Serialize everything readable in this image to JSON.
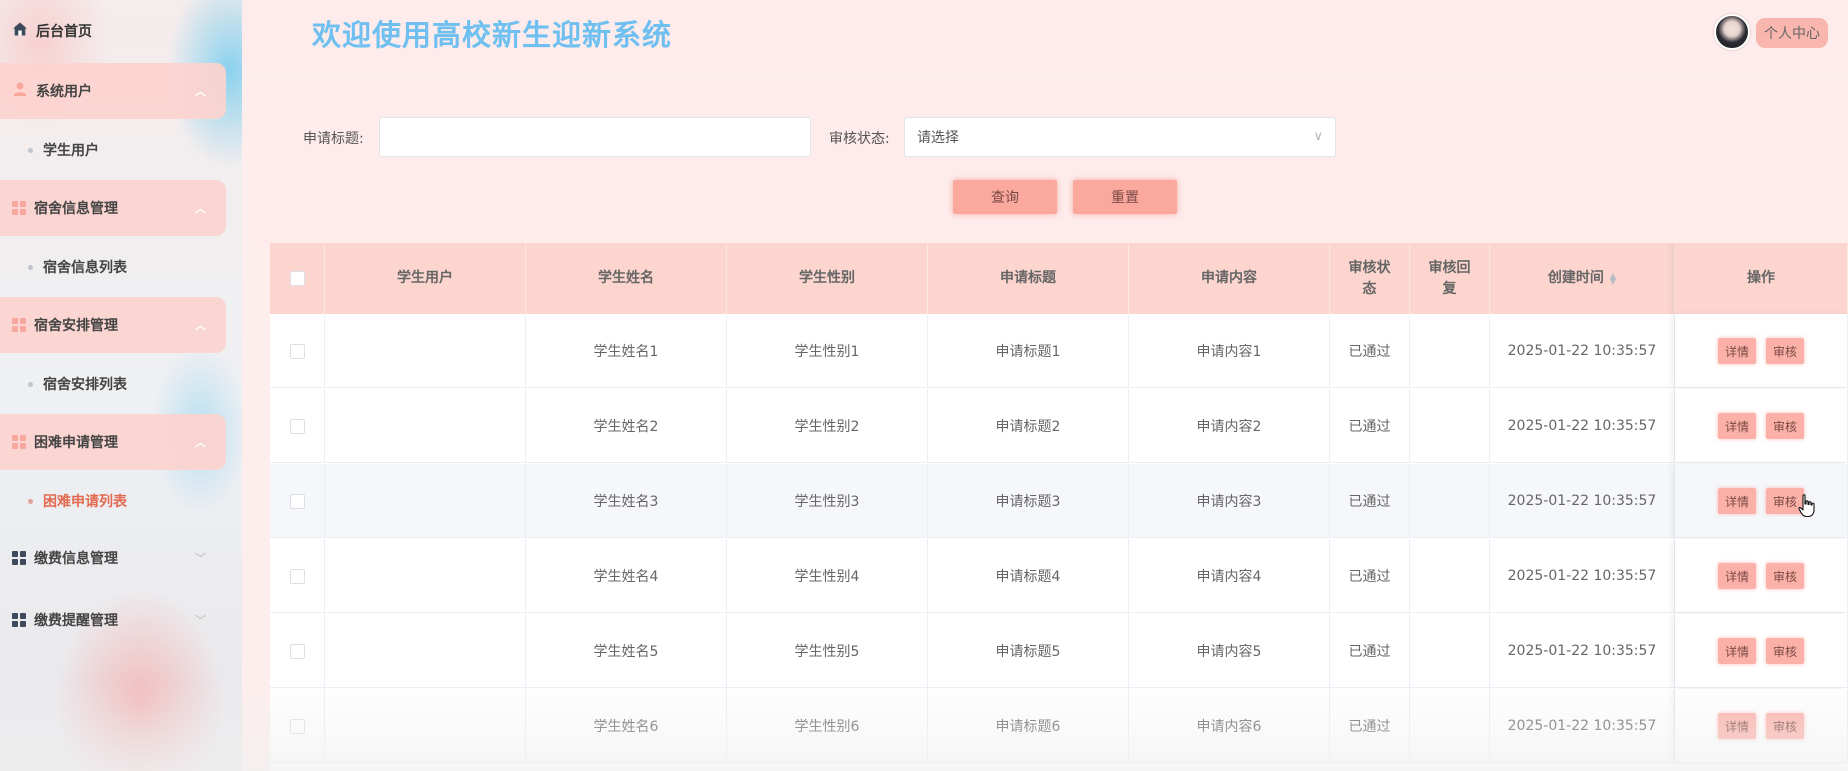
{
  "header": {
    "title": "欢迎使用高校新生迎新系统",
    "profile_label": "个人中心"
  },
  "sidebar": {
    "home": "后台首页",
    "groups": [
      {
        "label": "系统用户",
        "icon": "user-icon",
        "sub": "学生用户"
      },
      {
        "label": "宿舍信息管理",
        "icon": "grid-icon",
        "sub": "宿舍信息列表"
      },
      {
        "label": "宿舍安排管理",
        "icon": "grid-icon",
        "sub": "宿舍安排列表"
      },
      {
        "label": "困难申请管理",
        "icon": "grid-icon",
        "sub": "困难申请列表"
      },
      {
        "label": "缴费信息管理",
        "icon": "grid-icon"
      },
      {
        "label": "缴费提醒管理",
        "icon": "grid-icon"
      }
    ]
  },
  "search": {
    "title_label": "申请标题:",
    "title_value": "",
    "status_label": "审核状态:",
    "status_placeholder": "请选择",
    "query_label": "查询",
    "reset_label": "重置"
  },
  "table": {
    "headers": [
      "学生用户",
      "学生姓名",
      "学生性别",
      "申请标题",
      "申请内容",
      "审核状态",
      "审核回复",
      "创建时间",
      "操作"
    ],
    "detail_label": "详情",
    "audit_label": "审核",
    "rows": [
      {
        "user": "",
        "name": "学生姓名1",
        "gender": "学生性别1",
        "title": "申请标题1",
        "content": "申请内容1",
        "status": "已通过",
        "reply": "",
        "time": "2025-01-22 10:35:57"
      },
      {
        "user": "",
        "name": "学生姓名2",
        "gender": "学生性别2",
        "title": "申请标题2",
        "content": "申请内容2",
        "status": "已通过",
        "reply": "",
        "time": "2025-01-22 10:35:57"
      },
      {
        "user": "",
        "name": "学生姓名3",
        "gender": "学生性别3",
        "title": "申请标题3",
        "content": "申请内容3",
        "status": "已通过",
        "reply": "",
        "time": "2025-01-22 10:35:57"
      },
      {
        "user": "",
        "name": "学生姓名4",
        "gender": "学生性别4",
        "title": "申请标题4",
        "content": "申请内容4",
        "status": "已通过",
        "reply": "",
        "time": "2025-01-22 10:35:57"
      },
      {
        "user": "",
        "name": "学生姓名5",
        "gender": "学生性别5",
        "title": "申请标题5",
        "content": "申请内容5",
        "status": "已通过",
        "reply": "",
        "time": "2025-01-22 10:35:57"
      },
      {
        "user": "",
        "name": "学生姓名6",
        "gender": "学生性别6",
        "title": "申请标题6",
        "content": "申请内容6",
        "status": "已通过",
        "reply": "",
        "time": "2025-01-22 10:35:57"
      }
    ]
  },
  "colors": {
    "accent": "#fba89f",
    "title_blue": "#6fbff0",
    "active_link": "#e36a50",
    "header_row": "#fcd5cf"
  }
}
